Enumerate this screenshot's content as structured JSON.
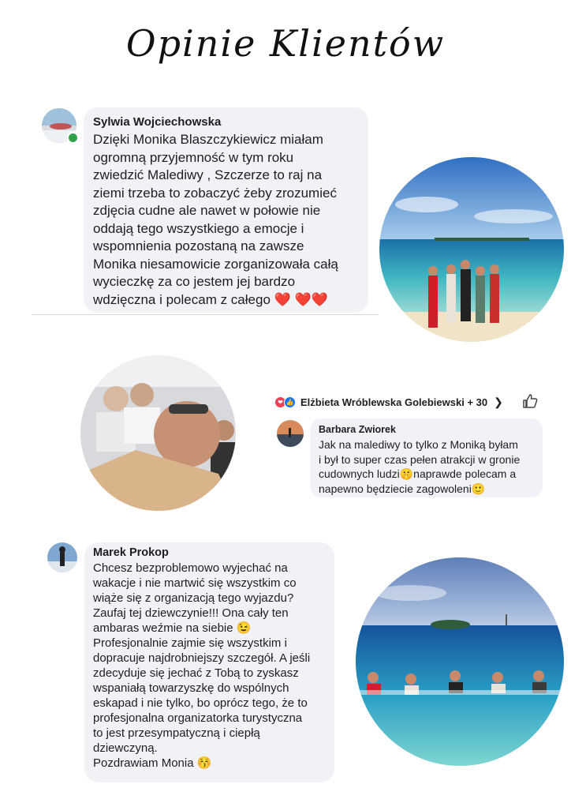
{
  "header": {
    "title": "Opinie Klientów"
  },
  "review1": {
    "name": "Sylwia Wojciechowska",
    "text": "Dzięki Monika Blaszczykiewicz miałam\nogromną przyjemność w tym roku\nzwiedzić Malediwy , Szczerze to raj na\nziemi trzeba to zobaczyć żeby zrozumieć\nzdjęcia cudne ale nawet w połowie nie\noddają tego wszystkiego a emocje i\nwspomnienia pozostaną na zawsze\nMonika niesamowicie zorganizowała całą\nwycieczkę  za co jestem jej bardzo\nwdzięczna i  polecam  z całego ❤️ ❤️❤️"
  },
  "review2": {
    "reactions_text": "Elżbieta Wróblewska Golebiewski + 30",
    "name": "Barbara Zwiorek",
    "text": "Jak na malediwy to tylko z Moniką byłam\ni był to super czas pełen atrakcji w gronie\ncudownych ludzi🤫naprawde polecam a\nnapewno będziecie zagowoleni🙂"
  },
  "review3": {
    "name": "Marek Prokop",
    "text": "Chcesz bezproblemowo wyjechać na\nwakacje i nie martwić się wszystkim co\nwiąże się z organizacją tego wyjazdu?\nZaufaj tej dziewczynie!!! Ona cały ten\nambaras weźmie na siebie 😉\nProfesjonalnie zajmie się wszystkim i\ndopracuje najdrobniejszy szczegół. A jeśli\nzdecyduje się jechać z Tobą to zyskasz\nwspaniałą towarzyszkę do wspólnych\neskapad i nie tylko, bo oprócz tego, że to\nprofesjonalna organizatorka turystyczna\nto jest przesympatyczną i ciepłą\ndziewczyną.\nPozdrawiam Monia 😚"
  },
  "icons": {
    "love": "love-reaction-icon",
    "like": "like-reaction-icon",
    "chevron": "chevron-right-icon",
    "thumb": "thumbs-up-icon"
  },
  "colors": {
    "bubble": "#f0f2f5",
    "online": "#31a24c",
    "love": "#f33e58",
    "like": "#1877f2"
  }
}
